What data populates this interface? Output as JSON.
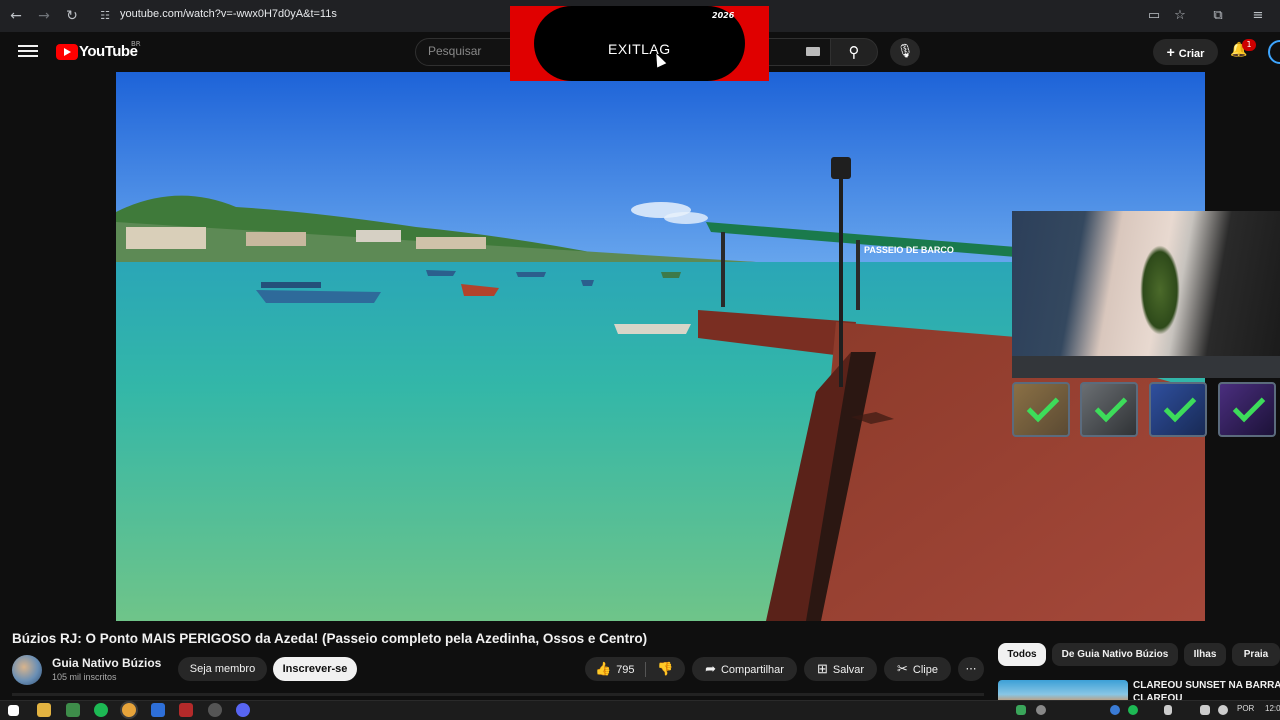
{
  "browser": {
    "url": "youtube.com/watch?v=-wwx0H7d0yA&t=11s"
  },
  "header": {
    "logo_text": "YouTube",
    "country_code": "BR",
    "search_placeholder": "Pesquisar",
    "create_label": "Criar",
    "notification_count": "1"
  },
  "overlay": {
    "brand": "EXITLAG",
    "year_badge": "2026"
  },
  "video": {
    "sign_text": "PASSEIO DE BARCO",
    "title": "Búzios RJ: O Ponto MAIS PERIGOSO da Azeda! (Passeio completo pela Azedinha, Ossos e Centro)"
  },
  "channel": {
    "name": "Guia Nativo Búzios",
    "subscribers": "105 mil inscritos",
    "join_label": "Seja membro",
    "subscribe_label": "Inscrever-se"
  },
  "actions": {
    "likes": "795",
    "share_label": "Compartilhar",
    "save_label": "Salvar",
    "clip_label": "Clipe"
  },
  "chips": [
    "Todos",
    "De Guia Nativo Búzios",
    "Ilhas",
    "Praia"
  ],
  "recommendation": {
    "title": "CLAREOU SUNSET NA BARRA CLAREOU"
  },
  "taskbar": {
    "language": "POR",
    "time": "12:0"
  }
}
